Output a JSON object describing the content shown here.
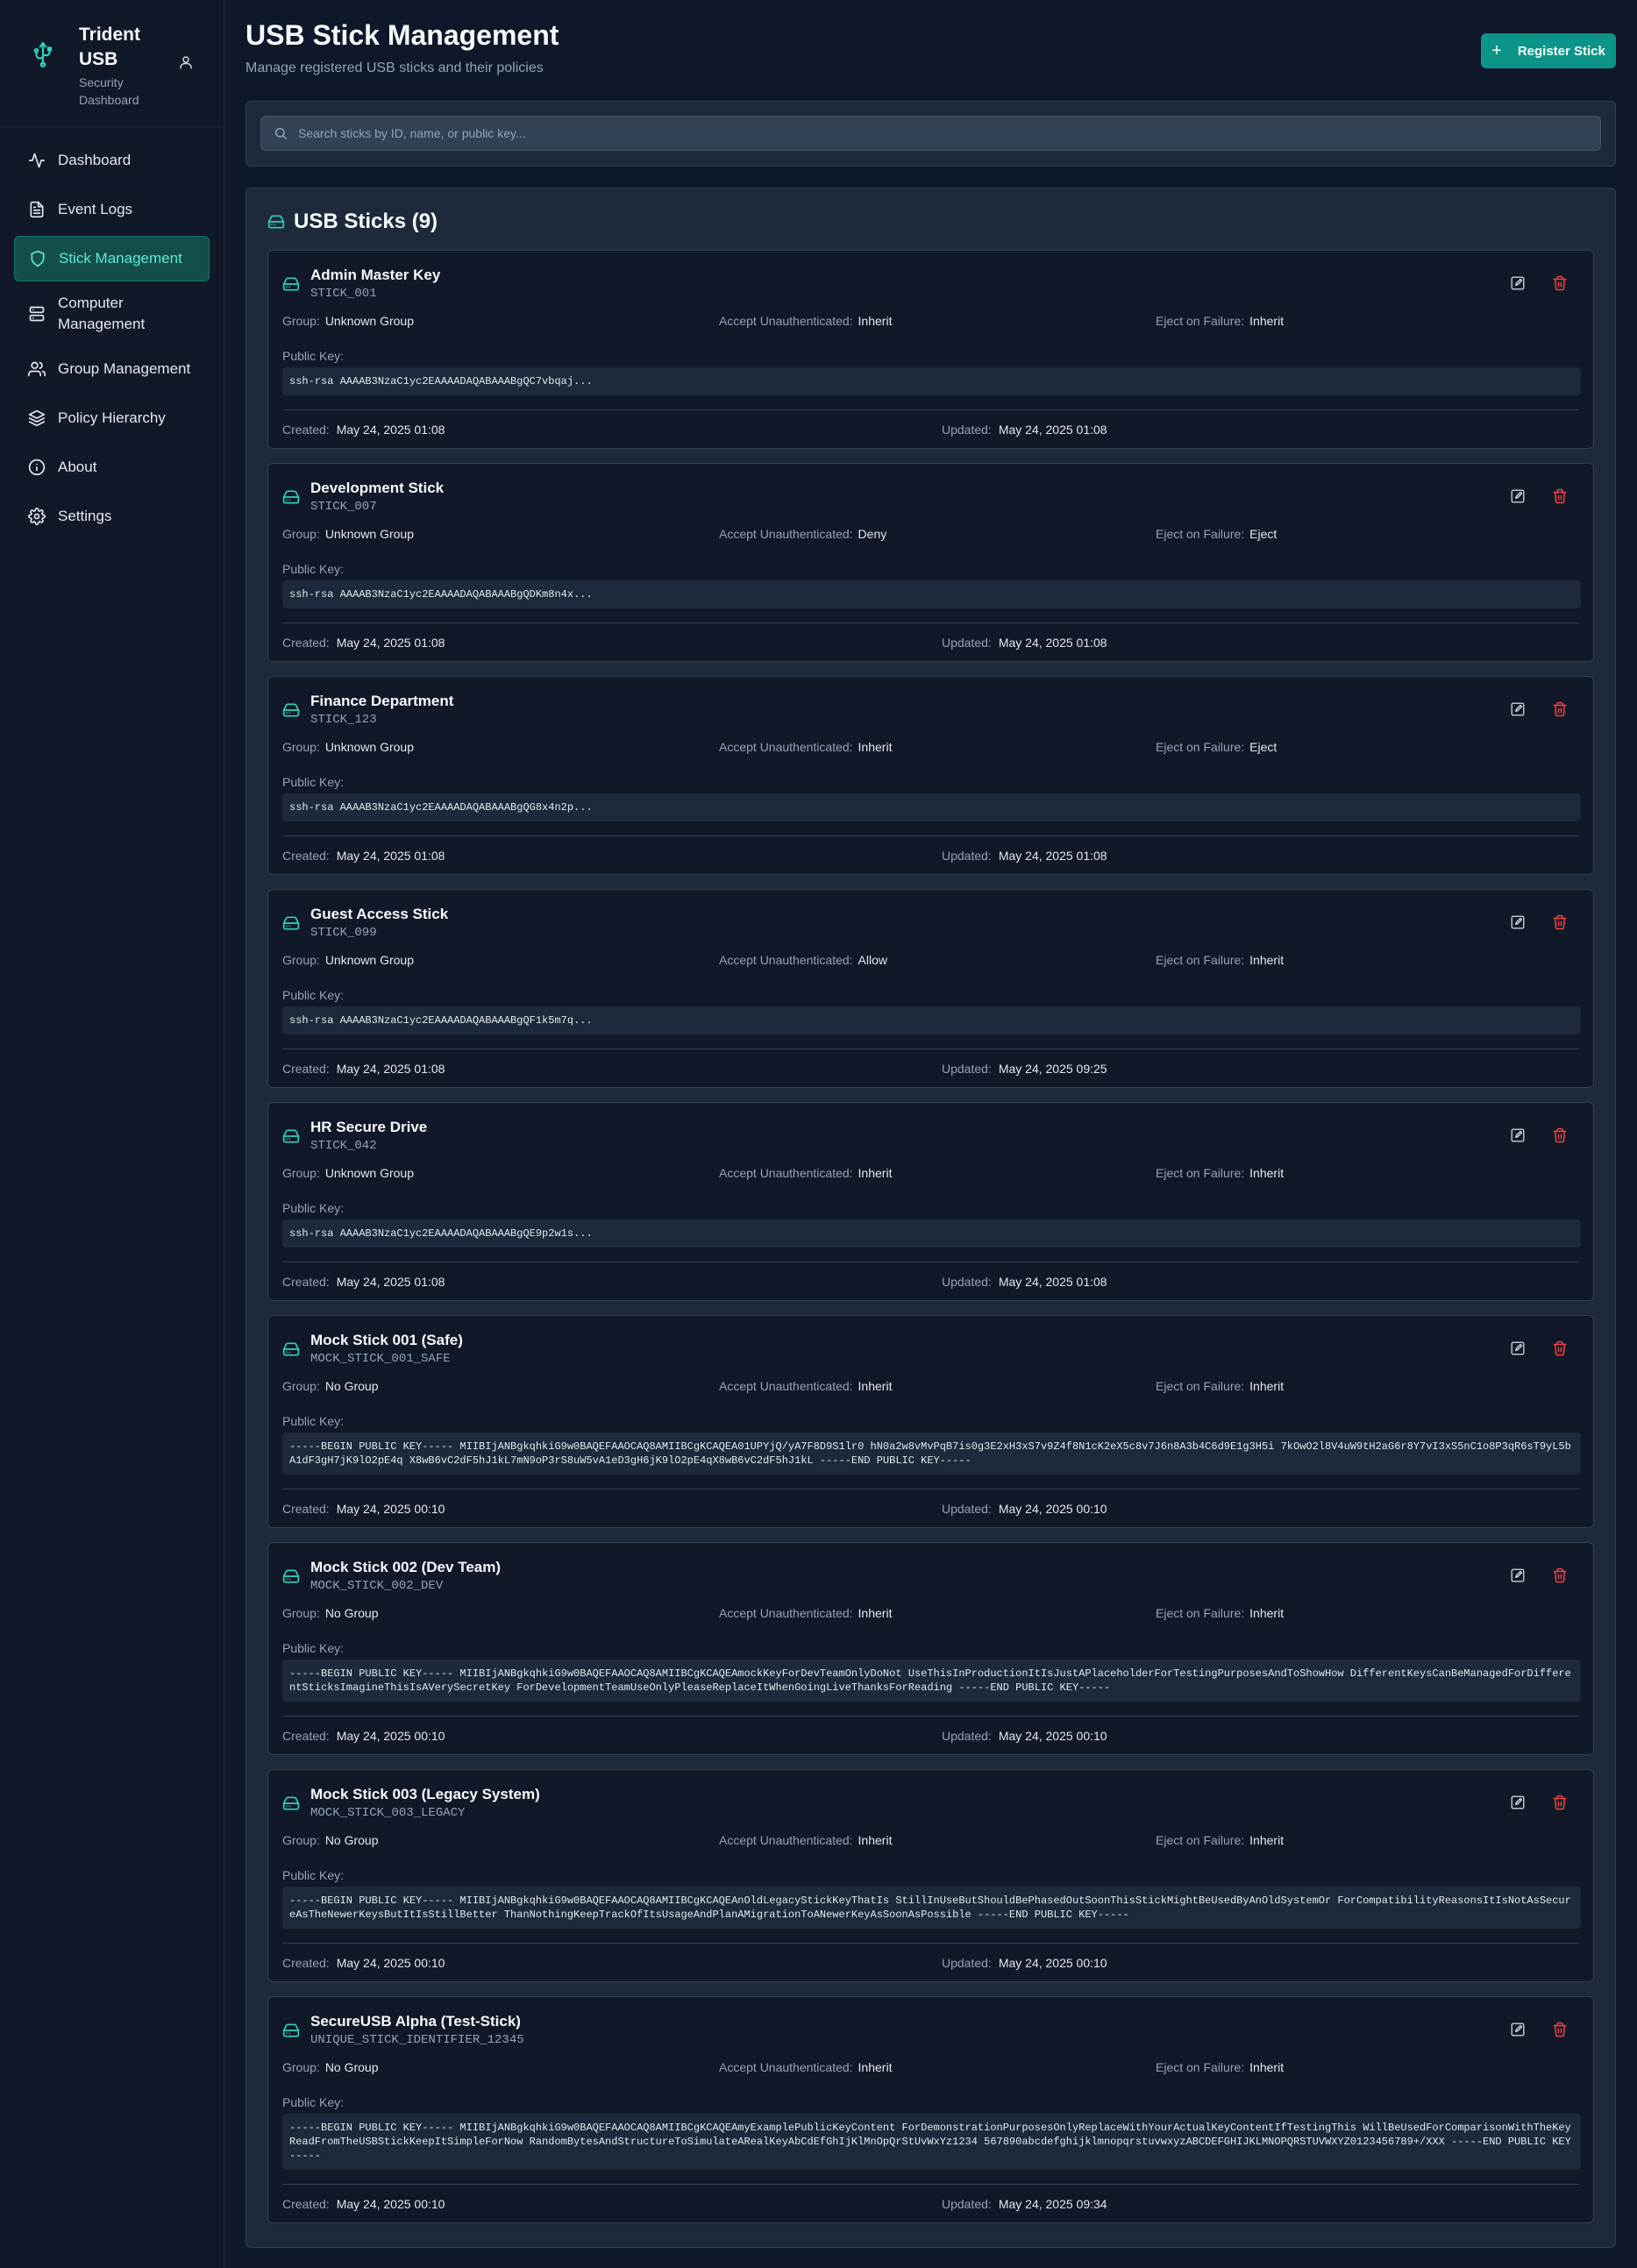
{
  "brand": {
    "title": "Trident USB",
    "subtitle": "Security Dashboard",
    "icon": "usb-icon"
  },
  "nav": [
    {
      "label": "Dashboard",
      "icon": "activity-icon",
      "active": false
    },
    {
      "label": "Event Logs",
      "icon": "file-text-icon",
      "active": false
    },
    {
      "label": "Stick Management",
      "icon": "shield-icon",
      "active": true
    },
    {
      "label": "Computer Management",
      "icon": "server-icon",
      "active": false
    },
    {
      "label": "Group Management",
      "icon": "users-icon",
      "active": false
    },
    {
      "label": "Policy Hierarchy",
      "icon": "layers-icon",
      "active": false
    },
    {
      "label": "About",
      "icon": "info-icon",
      "active": false
    },
    {
      "label": "Settings",
      "icon": "gear-icon",
      "active": false
    }
  ],
  "header": {
    "title": "USB Stick Management",
    "subtitle": "Manage registered USB sticks and their policies",
    "register_label": "Register Stick"
  },
  "search": {
    "placeholder": "Search sticks by ID, name, or public key..."
  },
  "list": {
    "title": "USB Sticks (9)",
    "labels": {
      "group": "Group:",
      "accept": "Accept Unauthenticated:",
      "eject": "Eject on Failure:",
      "public_key": "Public Key:",
      "created": "Created:",
      "updated": "Updated:"
    },
    "sticks": [
      {
        "name": "Admin Master Key",
        "id": "STICK_001",
        "group": "Unknown Group",
        "accept": "Inherit",
        "eject": "Inherit",
        "public_key": "ssh-rsa AAAAB3NzaC1yc2EAAAADAQABAAABgQC7vbqaj...",
        "created": "May 24, 2025 01:08",
        "updated": "May 24, 2025 01:08"
      },
      {
        "name": "Development Stick",
        "id": "STICK_007",
        "group": "Unknown Group",
        "accept": "Deny",
        "eject": "Eject",
        "public_key": "ssh-rsa AAAAB3NzaC1yc2EAAAADAQABAAABgQDKm8n4x...",
        "created": "May 24, 2025 01:08",
        "updated": "May 24, 2025 01:08"
      },
      {
        "name": "Finance Department",
        "id": "STICK_123",
        "group": "Unknown Group",
        "accept": "Inherit",
        "eject": "Eject",
        "public_key": "ssh-rsa AAAAB3NzaC1yc2EAAAADAQABAAABgQG8x4n2p...",
        "created": "May 24, 2025 01:08",
        "updated": "May 24, 2025 01:08"
      },
      {
        "name": "Guest Access Stick",
        "id": "STICK_099",
        "group": "Unknown Group",
        "accept": "Allow",
        "eject": "Inherit",
        "public_key": "ssh-rsa AAAAB3NzaC1yc2EAAAADAQABAAABgQF1k5m7q...",
        "created": "May 24, 2025 01:08",
        "updated": "May 24, 2025 09:25"
      },
      {
        "name": "HR Secure Drive",
        "id": "STICK_042",
        "group": "Unknown Group",
        "accept": "Inherit",
        "eject": "Inherit",
        "public_key": "ssh-rsa AAAAB3NzaC1yc2EAAAADAQABAAABgQE9p2w1s...",
        "created": "May 24, 2025 01:08",
        "updated": "May 24, 2025 01:08"
      },
      {
        "name": "Mock Stick 001 (Safe)",
        "id": "MOCK_STICK_001_SAFE",
        "group": "No Group",
        "accept": "Inherit",
        "eject": "Inherit",
        "public_key": "-----BEGIN PUBLIC KEY----- MIIBIjANBgkqhkiG9w0BAQEFAAOCAQ8AMIIBCgKCAQEA01UPYjQ/yA7F8D9S1lr0 hN0a2w8vMvPqB7is0g3E2xH3xS7v9Z4f8N1cK2eX5c8v7J6n8A3b4C6d9E1g3H5i 7kOwO2l8V4uW9tH2aG6r8Y7vI3xS5nC1o8P3qR6sT9yL5bA1dF3gH7jK9lO2pE4q X8wB6vC2dF5hJ1kL7mN9oP3rS8uW5vA1eD3gH6jK9lO2pE4qX8wB6vC2dF5hJ1kL -----END PUBLIC KEY-----",
        "created": "May 24, 2025 00:10",
        "updated": "May 24, 2025 00:10"
      },
      {
        "name": "Mock Stick 002 (Dev Team)",
        "id": "MOCK_STICK_002_DEV",
        "group": "No Group",
        "accept": "Inherit",
        "eject": "Inherit",
        "public_key": "-----BEGIN PUBLIC KEY----- MIIBIjANBgkqhkiG9w0BAQEFAAOCAQ8AMIIBCgKCAQEAmockKeyForDevTeamOnlyDoNot UseThisInProductionItIsJustAPlaceholderForTestingPurposesAndToShowHow DifferentKeysCanBeManagedForDifferentSticksImagineThisIsAVerySecretKey ForDevelopmentTeamUseOnlyPleaseReplaceItWhenGoingLiveThanksForReading -----END PUBLIC KEY-----",
        "created": "May 24, 2025 00:10",
        "updated": "May 24, 2025 00:10"
      },
      {
        "name": "Mock Stick 003 (Legacy System)",
        "id": "MOCK_STICK_003_LEGACY",
        "group": "No Group",
        "accept": "Inherit",
        "eject": "Inherit",
        "public_key": "-----BEGIN PUBLIC KEY----- MIIBIjANBgkqhkiG9w0BAQEFAAOCAQ8AMIIBCgKCAQEAnOldLegacyStickKeyThatIs StillInUseButShouldBePhasedOutSoonThisStickMightBeUsedByAnOldSystemOr ForCompatibilityReasonsItIsNotAsSecureAsTheNewerKeysButItIsStillBetter ThanNothingKeepTrackOfItsUsageAndPlanAMigrationToANewerKeyAsSoonAsPossible -----END PUBLIC KEY-----",
        "created": "May 24, 2025 00:10",
        "updated": "May 24, 2025 00:10"
      },
      {
        "name": "SecureUSB Alpha (Test-Stick)",
        "id": "UNIQUE_STICK_IDENTIFIER_12345",
        "group": "No Group",
        "accept": "Inherit",
        "eject": "Inherit",
        "public_key": "-----BEGIN PUBLIC KEY----- MIIBIjANBgkqhkiG9w0BAQEFAAOCAQ8AMIIBCgKCAQEAmyExamplePublicKeyContent ForDemonstrationPurposesOnlyReplaceWithYourActualKeyContentIfTestingThis WillBeUsedForComparisonWithTheKeyReadFromTheUSBStickKeepItSimpleForNow RandomBytesAndStructureToSimulateARealKeyAbCdEfGhIjKlMnOpQrStUvWxYz1234 567890abcdefghijklmnopqrstuvwxyzABCDEFGHIJKLMNOPQRSTUVWXYZ0123456789+/XXX -----END PUBLIC KEY-----",
        "created": "May 24, 2025 00:10",
        "updated": "May 24, 2025 09:34"
      }
    ]
  }
}
